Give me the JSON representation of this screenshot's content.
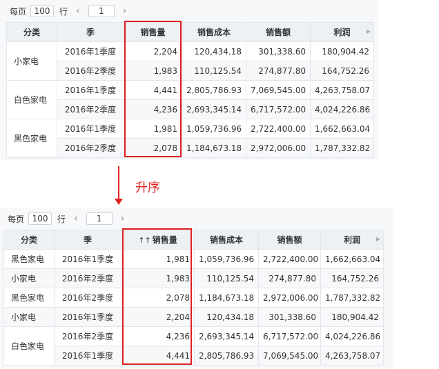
{
  "top": {
    "toolbar": {
      "per_page_label": "每页",
      "rows_per_page": "100",
      "rows_suffix": "行",
      "prev_icon": "‹",
      "page_number": "1",
      "next_icon": "›"
    },
    "headers": [
      "分类",
      "季",
      "销售量",
      "销售成本",
      "销售额",
      "利润"
    ],
    "groups": [
      {
        "category": "小家电",
        "rows": [
          [
            "2016年1季度",
            "2,204",
            "120,434.18",
            "301,338.60",
            "180,904.42"
          ],
          [
            "2016年2季度",
            "1,983",
            "110,125.54",
            "274,877.80",
            "164,752.26"
          ]
        ]
      },
      {
        "category": "白色家电",
        "rows": [
          [
            "2016年1季度",
            "4,441",
            "2,805,786.93",
            "7,069,545.00",
            "4,263,758.07"
          ],
          [
            "2016年2季度",
            "4,236",
            "2,693,345.14",
            "6,717,572.00",
            "4,024,226.86"
          ]
        ]
      },
      {
        "category": "黑色家电",
        "rows": [
          [
            "2016年1季度",
            "1,981",
            "1,059,736.96",
            "2,722,400.00",
            "1,662,663.04"
          ],
          [
            "2016年2季度",
            "2,078",
            "1,184,673.18",
            "2,972,006.00",
            "1,787,332.82"
          ]
        ]
      }
    ]
  },
  "arrow_label": "升序",
  "bottom": {
    "toolbar": {
      "per_page_label": "每页",
      "rows_per_page": "100",
      "rows_suffix": "行",
      "prev_icon": "‹",
      "page_number": "1",
      "next_icon": "›"
    },
    "sort_icon": "↑↑",
    "headers": [
      "分类",
      "季",
      "销售量",
      "销售成本",
      "销售额",
      "利润"
    ],
    "rows": [
      [
        "黑色家电",
        "2016年1季度",
        "1,981",
        "1,059,736.96",
        "2,722,400.00",
        "1,662,663.04"
      ],
      [
        "小家电",
        "2016年2季度",
        "1,983",
        "110,125.54",
        "274,877.80",
        "164,752.26"
      ],
      [
        "黑色家电",
        "2016年2季度",
        "2,078",
        "1,184,673.18",
        "2,972,006.00",
        "1,787,332.82"
      ],
      [
        "小家电",
        "2016年1季度",
        "2,204",
        "120,434.18",
        "301,338.60",
        "180,904.42"
      ],
      [
        "白色家电",
        "2016年2季度",
        "4,236",
        "2,693,345.14",
        "6,717,572.00",
        "4,024,226.86"
      ],
      [
        "",
        "2016年1季度",
        "4,441",
        "2,805,786.93",
        "7,069,545.00",
        "4,263,758.07"
      ]
    ],
    "merged_last_category": "白色家电"
  },
  "colors": {
    "highlight": "#e02020",
    "header_bg": "#eef1f4",
    "alt_row": "#f7f8fa"
  }
}
